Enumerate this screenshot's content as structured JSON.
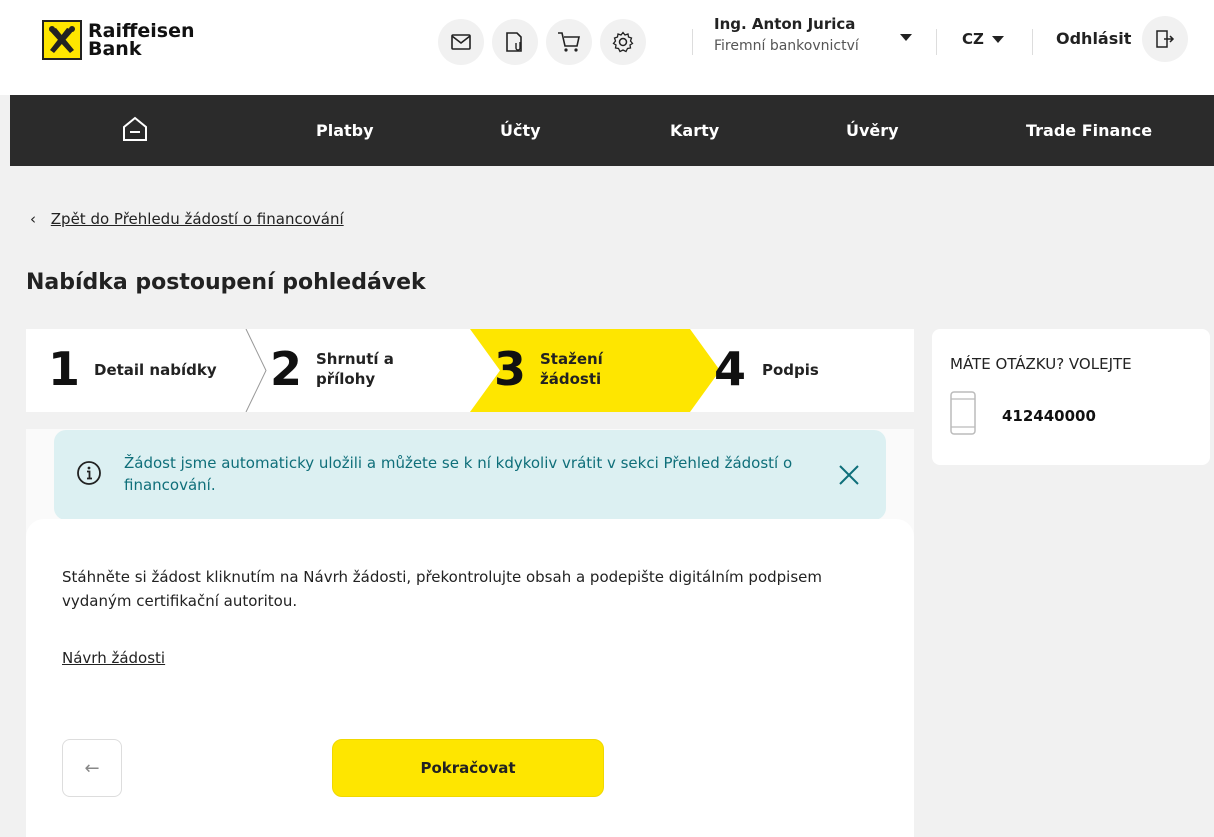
{
  "brand": {
    "line1": "Raiffeisen",
    "line2": "Bank",
    "yellow": "#fee600"
  },
  "header": {
    "icons": [
      "envelope-icon",
      "document-icon",
      "cart-icon",
      "gear-icon"
    ],
    "user_name": "Ing. Anton Jurica",
    "user_role": "Firemní bankovnictví",
    "language": "CZ",
    "logout_label": "Odhlásit"
  },
  "nav": {
    "items": [
      "Platby",
      "Účty",
      "Karty",
      "Úvěry",
      "Trade Finance"
    ]
  },
  "page": {
    "back_link": "Zpět do Přehledu žádostí o financování",
    "title": "Nabídka postoupení pohledávek"
  },
  "stepper": {
    "steps": [
      {
        "num": "1",
        "label": "Detail nabídky"
      },
      {
        "num": "2",
        "label": "Shrnutí a přílohy"
      },
      {
        "num": "3",
        "label": "Stažení žádosti"
      },
      {
        "num": "4",
        "label": "Podpis"
      }
    ],
    "active_step": 3
  },
  "banner": {
    "text": "Žádost jsme automaticky uložili a můžete se k ní kdykoliv vrátit v sekci  Přehled žádostí o financování."
  },
  "card": {
    "text": "Stáhněte si žádost kliknutím na Návrh žádosti, překontrolujte obsah a podepište digitálním podpisem vydaným certifikační autoritou.",
    "link": "Návrh žádosti",
    "back_button": "←",
    "continue_button": "Pokračovat"
  },
  "help": {
    "title": "MÁTE OTÁZKU? VOLEJTE",
    "phone": "412440000"
  }
}
